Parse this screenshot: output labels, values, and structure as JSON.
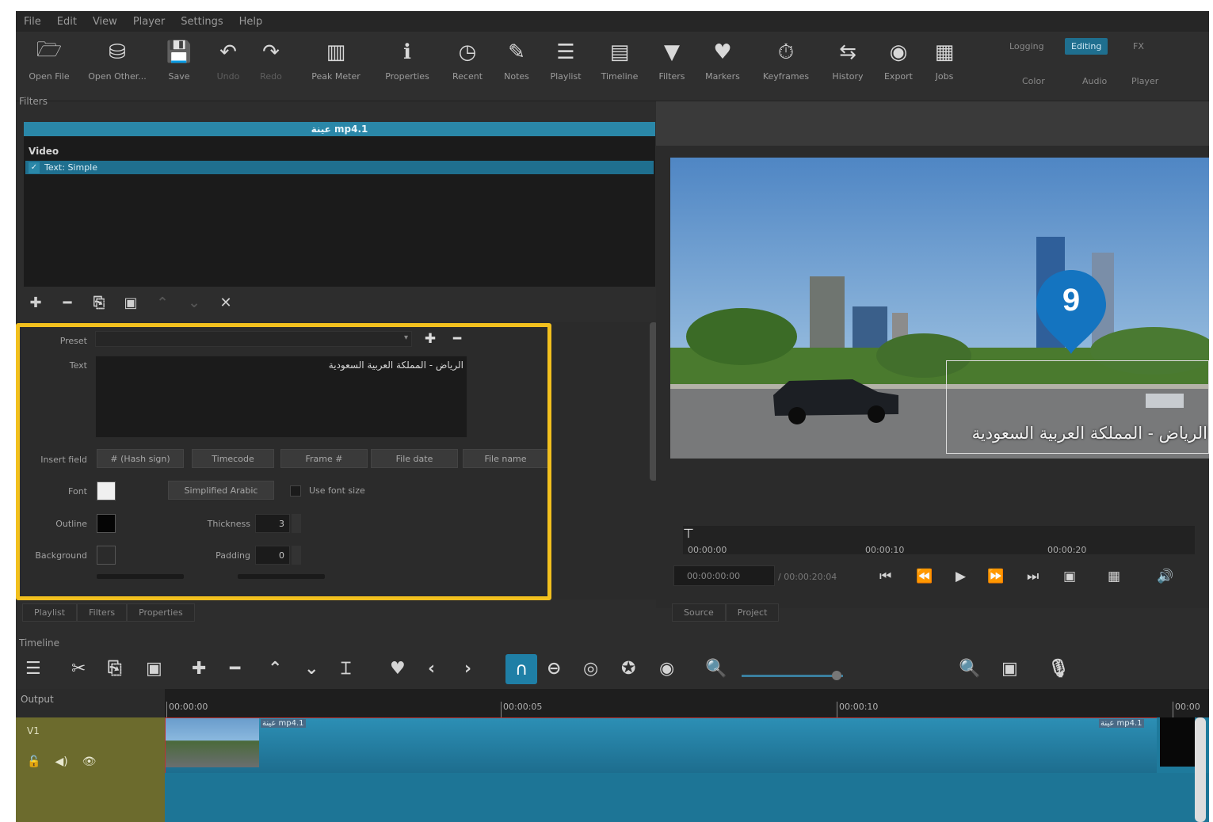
{
  "menu": [
    "File",
    "Edit",
    "View",
    "Player",
    "Settings",
    "Help"
  ],
  "toolbar": {
    "buttons": [
      {
        "label": "Open File",
        "icon": "folder-icon"
      },
      {
        "label": "Open Other...",
        "icon": "open-other-icon"
      },
      {
        "label": "Save",
        "icon": "save-icon"
      },
      {
        "label": "Undo",
        "icon": "undo-icon"
      },
      {
        "label": "Redo",
        "icon": "redo-icon"
      },
      {
        "label": "Peak Meter",
        "icon": "peak-meter-icon"
      },
      {
        "label": "Properties",
        "icon": "info-icon"
      },
      {
        "label": "Recent",
        "icon": "clock-icon"
      },
      {
        "label": "Notes",
        "icon": "notes-icon"
      },
      {
        "label": "Playlist",
        "icon": "list-icon"
      },
      {
        "label": "Timeline",
        "icon": "timeline-icon"
      },
      {
        "label": "Filters",
        "icon": "funnel-icon"
      },
      {
        "label": "Markers",
        "icon": "marker-icon"
      },
      {
        "label": "Keyframes",
        "icon": "stopwatch-icon"
      },
      {
        "label": "History",
        "icon": "history-icon"
      },
      {
        "label": "Export",
        "icon": "export-icon"
      },
      {
        "label": "Jobs",
        "icon": "jobs-icon"
      }
    ],
    "layouts": [
      "Logging",
      "Editing",
      "FX",
      "Color",
      "Audio",
      "Player"
    ]
  },
  "filters": {
    "title": "Filters",
    "clip_name": "عينة mp4.1",
    "section": "Video",
    "applied": "Text: Simple"
  },
  "editor": {
    "preset_label": "Preset",
    "text_label": "Text",
    "text_value": "الرياض - المملكة العربية السعودية",
    "insert_label": "Insert field",
    "insert_buttons": [
      "# (Hash sign)",
      "Timecode",
      "Frame #",
      "File date",
      "File name"
    ],
    "font_label": "Font",
    "font_button": "Simplified Arabic",
    "use_font_size": "Use font size",
    "outline_label": "Outline",
    "thickness_label": "Thickness",
    "thickness_value": "3",
    "background_label": "Background",
    "padding_label": "Padding",
    "padding_value": "0"
  },
  "tabs_left": [
    "Playlist",
    "Filters",
    "Properties"
  ],
  "tabs_right": [
    "Source",
    "Project"
  ],
  "player": {
    "overlay_text": "الرياض - المملكة العربية السعودية",
    "marker_number": "9",
    "ticks": [
      "00:00:00",
      "00:00:10",
      "00:00:20"
    ],
    "current_tc": "00:00:00:00",
    "total_tc": "/ 00:00:20:04"
  },
  "timeline": {
    "title": "Timeline",
    "output_label": "Output",
    "track_label": "V1",
    "ruler": [
      "00:00:00",
      "00:00:05",
      "00:00:10",
      "00:00"
    ],
    "clip_label": "عينة mp4.1"
  },
  "colors": {
    "accent": "#2a87a8",
    "highlight": "#f2c01e",
    "track_head": "#6c6b2d"
  }
}
